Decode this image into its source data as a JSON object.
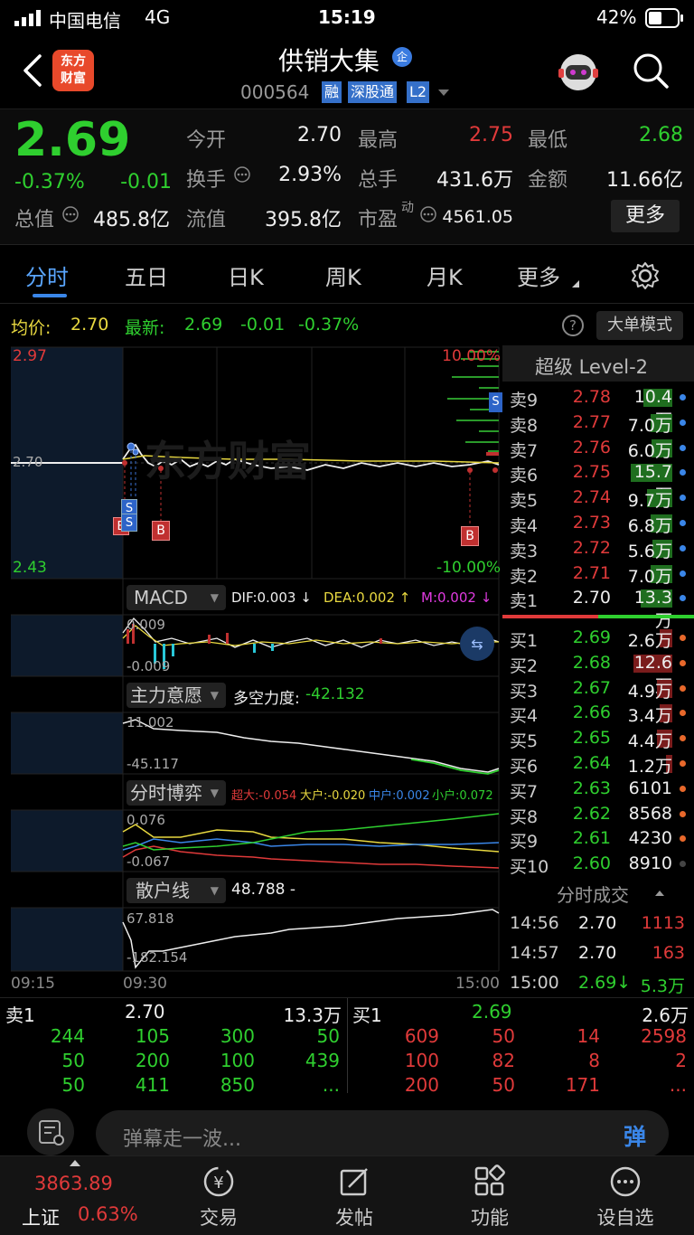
{
  "status": {
    "carrier": "中国电信",
    "network": "4G",
    "time": "15:19",
    "battery": "42%"
  },
  "header": {
    "logo_line1": "东方",
    "logo_line2": "财富",
    "stock_name": "供销大集",
    "name_badge": "企",
    "code": "000564",
    "tags": [
      "融",
      "深股通",
      "L2"
    ]
  },
  "quote": {
    "price": "2.69",
    "change_pct": "-0.37%",
    "change": "-0.01",
    "open_label": "今开",
    "open": "2.70",
    "high_label": "最高",
    "high": "2.75",
    "low_label": "最低",
    "low": "2.68",
    "turnover_label": "换手",
    "turnover": "2.93%",
    "volume_label": "总手",
    "volume": "431.6万",
    "amount_label": "金额",
    "amount": "11.66亿",
    "mcap_label": "总值",
    "mcap": "485.8亿",
    "float_label": "流值",
    "float": "395.8亿",
    "pe_label": "市盈",
    "pe_sup": "动",
    "pe": "4561.05",
    "more_button": "更多"
  },
  "tabs": [
    "分时",
    "五日",
    "日K",
    "周K",
    "月K",
    "更多"
  ],
  "chart_info": {
    "avg_label": "均价:",
    "avg": "2.70",
    "latest_label": "最新:",
    "latest": "2.69",
    "latest_change": "-0.01",
    "latest_pct": "-0.37%",
    "mode_button": "大单模式",
    "help": "?"
  },
  "main_chart": {
    "y_top": "2.97",
    "y_mid": "2.70",
    "y_bottom": "2.43",
    "pct_top": "10.00%",
    "pct_bottom": "-10.00%",
    "watermark": "东方财富",
    "markers": [
      "S",
      "S",
      "B",
      "B",
      "B",
      "S"
    ]
  },
  "macd": {
    "selector": "MACD",
    "dif": "DIF:0.003 ↓",
    "dea": "DEA:0.002 ↑",
    "m": "M:0.002 ↓",
    "y_top": "0.009",
    "y_bottom": "-0.009"
  },
  "main_force": {
    "selector": "主力意愿",
    "label": "多空力度:",
    "value": "-42.132",
    "y_top": "11.002",
    "y_bottom": "-45.117"
  },
  "game": {
    "selector": "分时博弈",
    "super": "超大:-0.054",
    "large": "大户:-0.020",
    "mid": "中户:0.002",
    "small": "小户:0.072",
    "y_top": "0.076",
    "y_bottom": "-0.067"
  },
  "retail": {
    "selector": "散户线",
    "value": "48.788 -",
    "y_top": "67.818",
    "y_bottom": "-182.154"
  },
  "time_axis": [
    "09:15",
    "09:30",
    "15:00"
  ],
  "book": {
    "title": "超级 Level-2",
    "asks": [
      {
        "label": "卖9",
        "price": "2.78",
        "vol": "10.4万"
      },
      {
        "label": "卖8",
        "price": "2.77",
        "vol": "7.0万"
      },
      {
        "label": "卖7",
        "price": "2.76",
        "vol": "6.0万"
      },
      {
        "label": "卖6",
        "price": "2.75",
        "vol": "15.7万"
      },
      {
        "label": "卖5",
        "price": "2.74",
        "vol": "9.7万"
      },
      {
        "label": "卖4",
        "price": "2.73",
        "vol": "6.8万"
      },
      {
        "label": "卖3",
        "price": "2.72",
        "vol": "5.6万"
      },
      {
        "label": "卖2",
        "price": "2.71",
        "vol": "7.0万"
      },
      {
        "label": "卖1",
        "price": "2.70",
        "vol": "13.3万"
      }
    ],
    "bids": [
      {
        "label": "买1",
        "price": "2.69",
        "vol": "2.6万"
      },
      {
        "label": "买2",
        "price": "2.68",
        "vol": "12.6万"
      },
      {
        "label": "买3",
        "price": "2.67",
        "vol": "4.9万"
      },
      {
        "label": "买4",
        "price": "2.66",
        "vol": "3.4万"
      },
      {
        "label": "买5",
        "price": "2.65",
        "vol": "4.4万"
      },
      {
        "label": "买6",
        "price": "2.64",
        "vol": "1.2万"
      },
      {
        "label": "买7",
        "price": "2.63",
        "vol": "6101"
      },
      {
        "label": "买8",
        "price": "2.62",
        "vol": "8568"
      },
      {
        "label": "买9",
        "price": "2.61",
        "vol": "4230"
      },
      {
        "label": "买10",
        "price": "2.60",
        "vol": "8910"
      }
    ],
    "trades_title": "分时成交",
    "trades": [
      {
        "time": "14:56",
        "price": "2.70",
        "vol": "1113"
      },
      {
        "time": "14:57",
        "price": "2.70",
        "vol": "163"
      },
      {
        "time": "15:00",
        "price": "2.69↓",
        "vol": "5.3万"
      }
    ]
  },
  "ticks": {
    "sell_label": "卖1",
    "sell_price": "2.70",
    "sell_vol": "13.3万",
    "buy_label": "买1",
    "buy_price": "2.69",
    "buy_vol": "2.6万",
    "sell_rows": [
      [
        "244",
        "105",
        "300",
        "50"
      ],
      [
        "50",
        "200",
        "100",
        "439"
      ],
      [
        "50",
        "411",
        "850",
        "..."
      ]
    ],
    "buy_rows": [
      [
        "609",
        "50",
        "14",
        "2598"
      ],
      [
        "100",
        "82",
        "8",
        "2"
      ],
      [
        "200",
        "50",
        "171",
        "..."
      ]
    ]
  },
  "comment": {
    "placeholder": "弹幕走一波...",
    "button": "弹"
  },
  "nav": {
    "index_value": "3863.89",
    "index_name": "上证",
    "index_pct": "0.63%",
    "items": [
      "交易",
      "发帖",
      "功能",
      "设自选"
    ]
  }
}
